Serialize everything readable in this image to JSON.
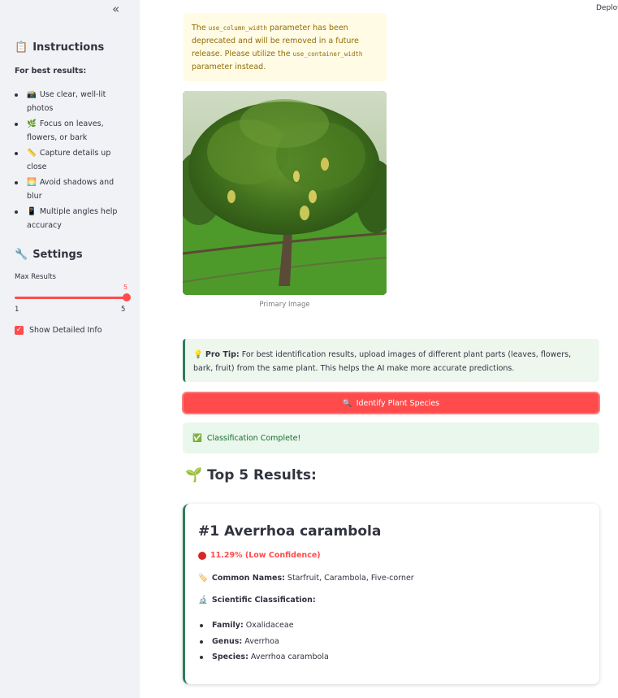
{
  "sidebar": {
    "collapse_icon": "«",
    "instructions_title": "Instructions",
    "instructions_icon": "📋",
    "best_results_label": "For best results:",
    "tips": [
      {
        "icon": "📸",
        "text": "Use clear, well-lit photos"
      },
      {
        "icon": "🌿",
        "text": "Focus on leaves, flowers, or bark"
      },
      {
        "icon": "📏",
        "text": "Capture details up close"
      },
      {
        "icon": "🌅",
        "text": "Avoid shadows and blur"
      },
      {
        "icon": "📱",
        "text": "Multiple angles help accuracy"
      }
    ],
    "settings_title": "Settings",
    "settings_icon": "🔧",
    "max_results_label": "Max Results",
    "max_results_value": "5",
    "slider_min": "1",
    "slider_max": "5",
    "slider_fraction": 1.0,
    "show_detailed_label": "Show Detailed Info",
    "show_detailed_checked": true
  },
  "header": {
    "deploy_label": "Deploy"
  },
  "warning": {
    "part1": "The ",
    "code1": "use_column_width",
    "part2": " parameter has been deprecated and will be removed in a future release. Please utilize the ",
    "code2": "use_container_width",
    "part3": " parameter instead."
  },
  "image": {
    "caption": "Primary Image"
  },
  "tip": {
    "icon": "💡",
    "label": "Pro Tip:",
    "text": " For best identification results, upload images of different plant parts (leaves, flowers, bark, fruit) from the same plant. This helps the AI make more accurate predictions."
  },
  "identify_button": {
    "icon": "🔍",
    "label": "Identify Plant Species"
  },
  "success": {
    "icon": "✅",
    "text": "Classification Complete!"
  },
  "results": {
    "icon": "🌱",
    "title": "Top 5 Results:"
  },
  "result_card": {
    "title": "#1 Averrhoa carambola",
    "confidence_text": "11.29% (Low Confidence)",
    "common_icon": "🏷️",
    "common_label": "Common Names:",
    "common_value": " Starfruit, Carambola, Five-corner",
    "sci_icon": "🔬",
    "sci_label": "Scientific Classification:",
    "taxonomy": [
      {
        "label": "Family:",
        "value": " Oxalidaceae"
      },
      {
        "label": "Genus:",
        "value": " Averrhoa"
      },
      {
        "label": "Species:",
        "value": " Averrhoa carambola"
      }
    ]
  },
  "colors": {
    "accent": "#ff4b4b",
    "sidebar_bg": "#f0f2f6",
    "success_bg": "#e9f7ec",
    "tip_bg": "#edf7ee",
    "warning_bg": "#fffbe5"
  }
}
